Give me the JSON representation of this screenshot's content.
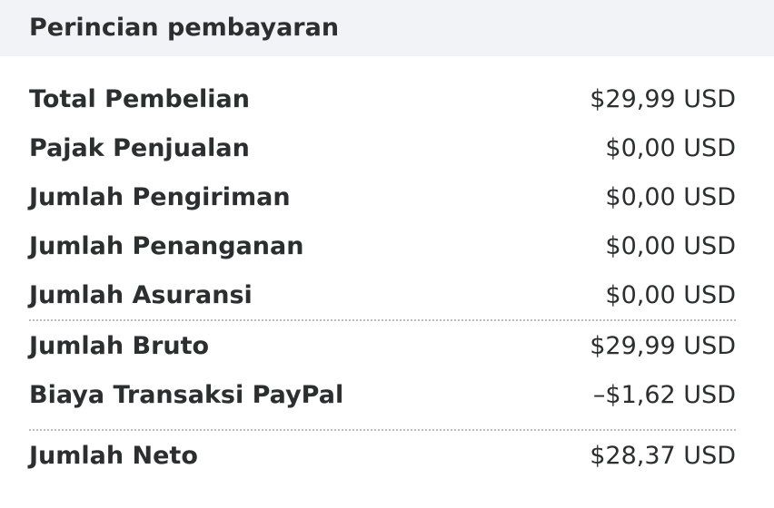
{
  "header": {
    "title": "Perincian pembayaran"
  },
  "rows": [
    {
      "label": "Total Pembelian",
      "value": "$29,99 USD"
    },
    {
      "label": "Pajak Penjualan",
      "value": "$0,00 USD"
    },
    {
      "label": "Jumlah Pengiriman",
      "value": "$0,00 USD"
    },
    {
      "label": "Jumlah Penanganan",
      "value": "$0,00 USD"
    },
    {
      "label": "Jumlah Asuransi",
      "value": "$0,00 USD"
    },
    {
      "label": "Jumlah Bruto",
      "value": "$29,99 USD"
    },
    {
      "label": "Biaya Transaksi PayPal",
      "value": "–$1,62 USD"
    },
    {
      "label": "Jumlah Neto",
      "value": "$28,37 USD"
    }
  ]
}
